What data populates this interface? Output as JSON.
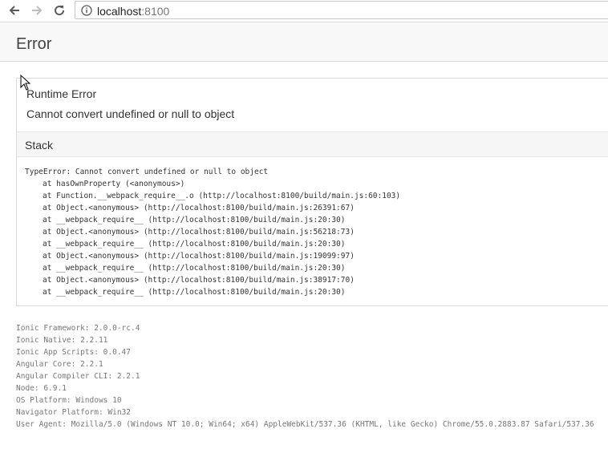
{
  "browser": {
    "url_host": "localhost",
    "url_port": ":8100",
    "icons": [
      "back-arrow-icon",
      "forward-arrow-icon",
      "reload-icon",
      "info-icon"
    ]
  },
  "page": {
    "title": "Error"
  },
  "error": {
    "title": "Runtime Error",
    "message": "Cannot convert undefined or null to object",
    "stack_label": "Stack",
    "stack_lines": [
      "TypeError: Cannot convert undefined or null to object",
      "at hasOwnProperty (<anonymous>)",
      "at Function.__webpack_require__.o (http://localhost:8100/build/main.js:60:103)",
      "at Object.<anonymous> (http://localhost:8100/build/main.js:26391:67)",
      "at __webpack_require__ (http://localhost:8100/build/main.js:20:30)",
      "at Object.<anonymous> (http://localhost:8100/build/main.js:56218:73)",
      "at __webpack_require__ (http://localhost:8100/build/main.js:20:30)",
      "at Object.<anonymous> (http://localhost:8100/build/main.js:19099:97)",
      "at __webpack_require__ (http://localhost:8100/build/main.js:20:30)",
      "at Object.<anonymous> (http://localhost:8100/build/main.js:38917:70)",
      "at __webpack_require__ (http://localhost:8100/build/main.js:20:30)"
    ]
  },
  "environment": [
    "Ionic Framework: 2.0.0-rc.4",
    "Ionic Native: 2.2.11",
    "Ionic App Scripts: 0.0.47",
    "Angular Core: 2.2.1",
    "Angular Compiler CLI: 2.2.1",
    "Node: 6.9.1",
    "OS Platform: Windows 10",
    "Navigator Platform: Win32",
    "User Agent: Mozilla/5.0 (Windows NT 10.0; Win64; x64) AppleWebKit/537.36 (KHTML, like Gecko) Chrome/55.0.2883.87 Safari/537.36"
  ]
}
